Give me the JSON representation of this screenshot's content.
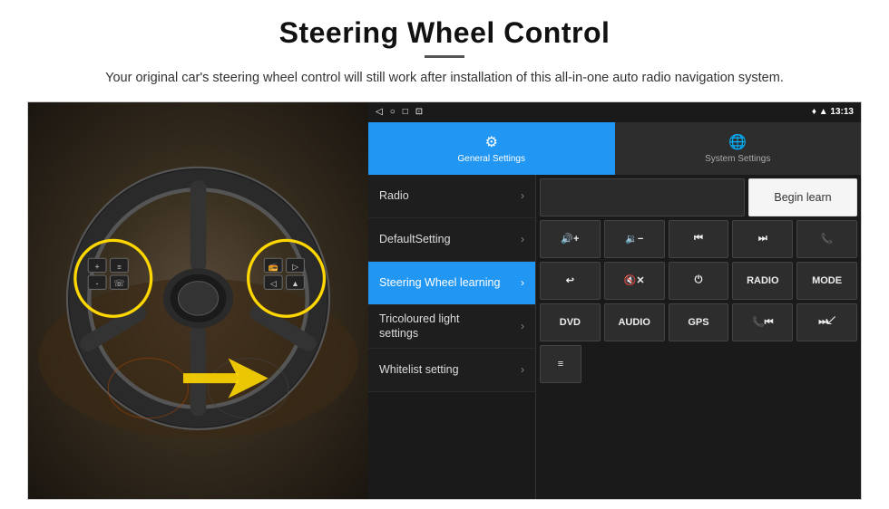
{
  "page": {
    "title": "Steering Wheel Control",
    "subtitle": "Your original car's steering wheel control will still work after installation of this all-in-one auto radio navigation system."
  },
  "status_bar": {
    "icons": [
      "◁",
      "○",
      "□",
      "⊡"
    ],
    "right_icons": "♥ ▲",
    "time": "13:13"
  },
  "tabs": [
    {
      "id": "general",
      "label": "General Settings",
      "active": true
    },
    {
      "id": "system",
      "label": "System Settings",
      "active": false
    }
  ],
  "menu_items": [
    {
      "id": "radio",
      "label": "Radio",
      "active": false
    },
    {
      "id": "default",
      "label": "DefaultSetting",
      "active": false
    },
    {
      "id": "steering",
      "label": "Steering Wheel learning",
      "active": true
    },
    {
      "id": "tricoloured",
      "label": "Tricoloured light settings",
      "active": false
    },
    {
      "id": "whitelist",
      "label": "Whitelist setting",
      "active": false
    }
  ],
  "controls": {
    "begin_learn_label": "Begin learn",
    "row1": [
      {
        "id": "vol-up",
        "label": "🔊+",
        "type": "icon"
      },
      {
        "id": "vol-down",
        "label": "🔉-",
        "type": "icon"
      },
      {
        "id": "prev",
        "label": "⏮",
        "type": "icon"
      },
      {
        "id": "next",
        "label": "⏭",
        "type": "icon"
      },
      {
        "id": "phone",
        "label": "📞",
        "type": "icon"
      }
    ],
    "row2": [
      {
        "id": "hang-up",
        "label": "↩",
        "type": "icon"
      },
      {
        "id": "mute",
        "label": "🔇x",
        "type": "icon"
      },
      {
        "id": "power",
        "label": "⏻",
        "type": "icon"
      },
      {
        "id": "radio-btn",
        "label": "RADIO",
        "type": "text"
      },
      {
        "id": "mode",
        "label": "MODE",
        "type": "text"
      }
    ],
    "row3": [
      {
        "id": "dvd",
        "label": "DVD",
        "type": "text"
      },
      {
        "id": "audio",
        "label": "AUDIO",
        "type": "text"
      },
      {
        "id": "gps",
        "label": "GPS",
        "type": "text"
      },
      {
        "id": "prev2",
        "label": "📞⏮",
        "type": "icon"
      },
      {
        "id": "next2",
        "label": "⏭↙",
        "type": "icon"
      }
    ],
    "row4_icon": "≡"
  }
}
